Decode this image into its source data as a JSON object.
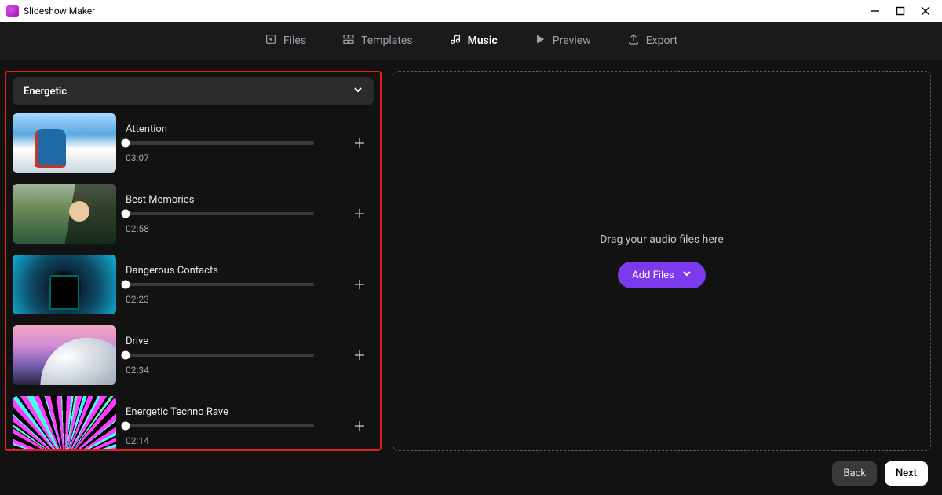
{
  "window": {
    "title": "Slideshow Maker"
  },
  "nav": {
    "files": "Files",
    "templates": "Templates",
    "music": "Music",
    "preview": "Preview",
    "export": "Export"
  },
  "category": {
    "label": "Energetic"
  },
  "tracks": [
    {
      "title": "Attention",
      "duration": "03:07"
    },
    {
      "title": "Best Memories",
      "duration": "02:58"
    },
    {
      "title": "Dangerous Contacts",
      "duration": "02:23"
    },
    {
      "title": "Drive",
      "duration": "02:34"
    },
    {
      "title": "Energetic Techno Rave",
      "duration": "02:14"
    }
  ],
  "dropzone": {
    "hint": "Drag your audio files here",
    "add_label": "Add Files"
  },
  "footer": {
    "back": "Back",
    "next": "Next"
  }
}
